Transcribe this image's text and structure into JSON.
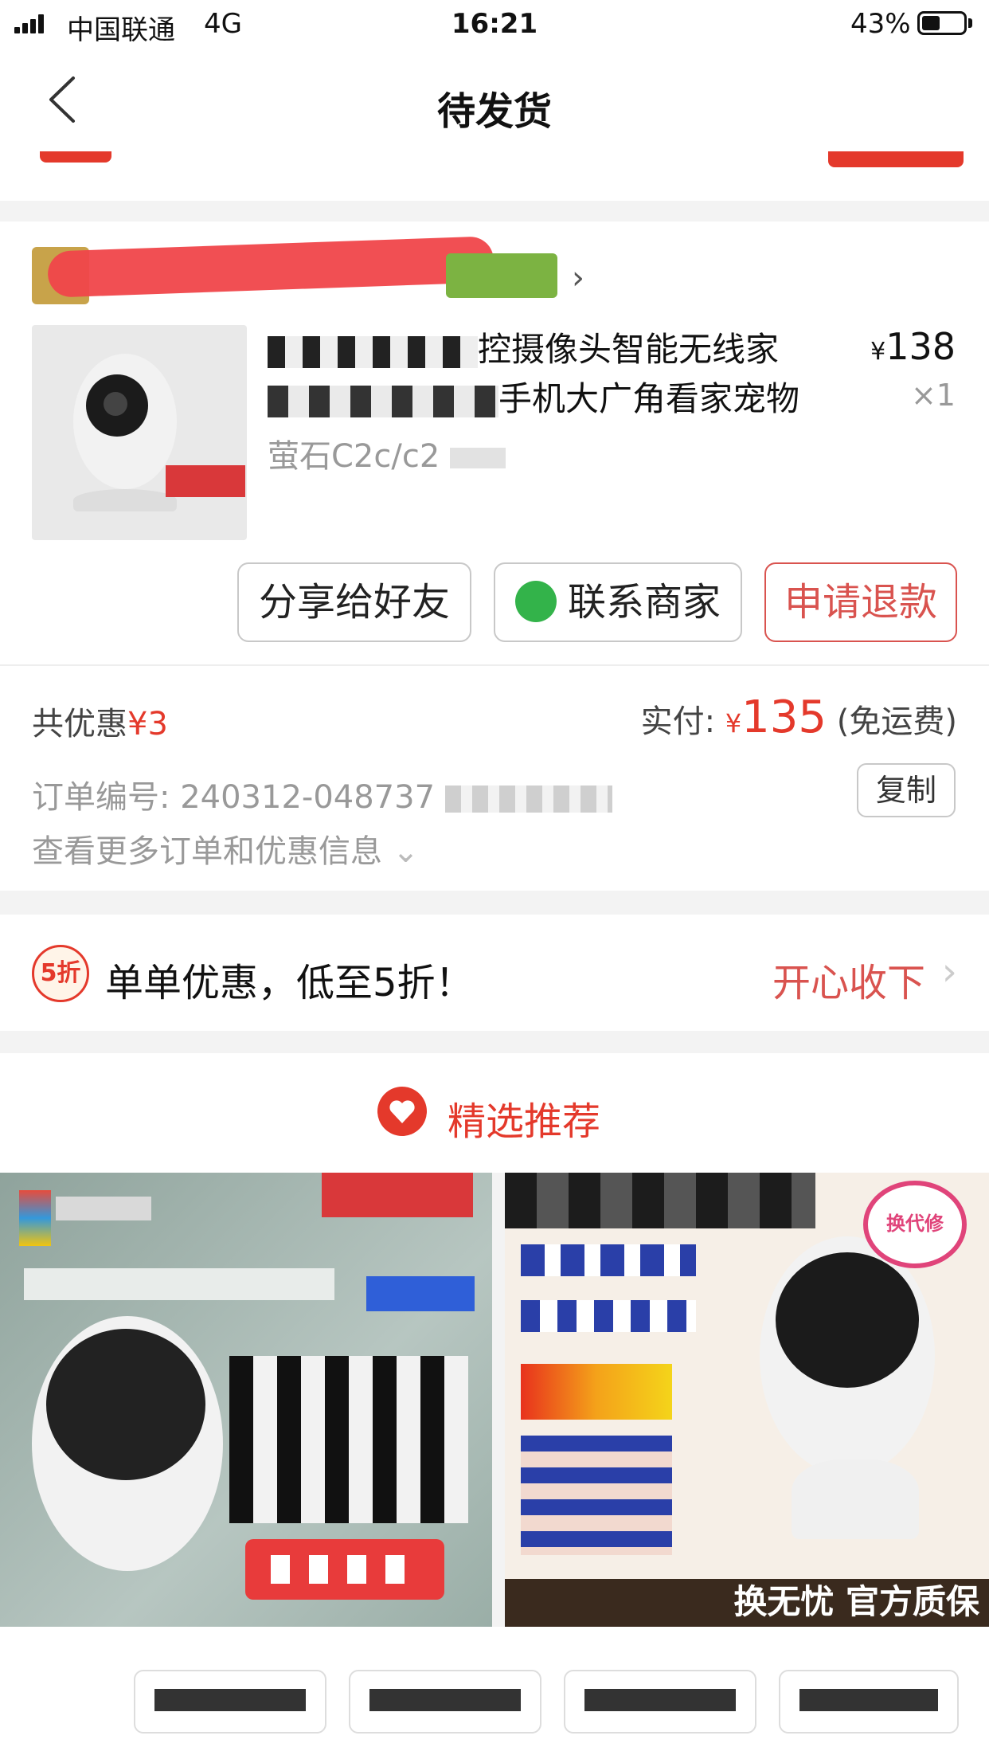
{
  "status_bar": {
    "carrier": "中国联通",
    "network": "4G",
    "time": "16:21",
    "battery": "43%",
    "battery_level": 0.43
  },
  "nav": {
    "title": "待发货"
  },
  "order": {
    "product_title": "监控摄像头智能无线家用手机大广角看家宠物",
    "product_title_visible_line1": "控摄像头智能无线家",
    "product_title_visible_line2": "手机大广角看家宠物",
    "spec": "萤石C2c/c2",
    "price_symbol": "¥",
    "price": "138",
    "quantity": "×1",
    "buttons": {
      "share": "分享给好友",
      "contact": "联系商家",
      "refund": "申请退款"
    },
    "discount_label": "共优惠",
    "discount_value": "¥3",
    "paid_label": "实付:",
    "paid_symbol": "¥",
    "paid_value": "135",
    "paid_note": "(免运费)",
    "order_no_label": "订单编号:",
    "order_no": "240312-048737",
    "copy": "复制",
    "more": "查看更多订单和优惠信息"
  },
  "promo": {
    "badge": "5折",
    "text": "单单优惠，低至5折！",
    "action": "开心收下"
  },
  "recommend": {
    "title": "精选推荐"
  },
  "recommend_items": {
    "right_banner_bottom": "换无忧 官方质保",
    "right_stamp": "换代修"
  },
  "colors": {
    "accent": "#e4392b",
    "wechat": "#33b34a"
  }
}
